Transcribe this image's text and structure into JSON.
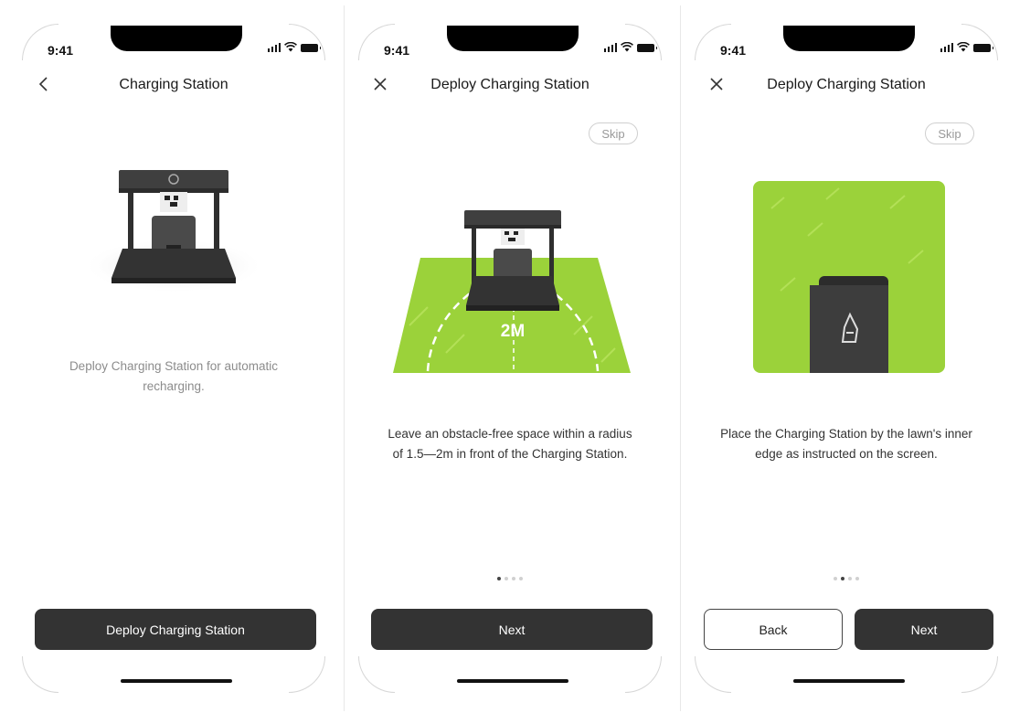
{
  "status_bar": {
    "time": "9:41"
  },
  "screens": [
    {
      "title": "Charging Station",
      "nav_icon": "chevron-left-icon",
      "description": "Deploy Charging Station for automatic recharging.",
      "primary_button": "Deploy Charging Station"
    },
    {
      "title": "Deploy Charging Station",
      "nav_icon": "close-icon",
      "skip": "Skip",
      "illustration_label": "2M",
      "description": "Leave an obstacle-free space within a radius of 1.5—2m in front of the Charging Station.",
      "page_indicator": {
        "current": 1,
        "total": 4
      },
      "primary_button": "Next"
    },
    {
      "title": "Deploy Charging Station",
      "nav_icon": "close-icon",
      "skip": "Skip",
      "description": "Place the Charging Station by the lawn's inner edge as instructed on the screen.",
      "page_indicator": {
        "current": 2,
        "total": 4
      },
      "secondary_button": "Back",
      "primary_button": "Next"
    }
  ],
  "colors": {
    "button_dark": "#333333",
    "lawn_green": "#9bd23a",
    "station_gray": "#3a3a3a"
  }
}
